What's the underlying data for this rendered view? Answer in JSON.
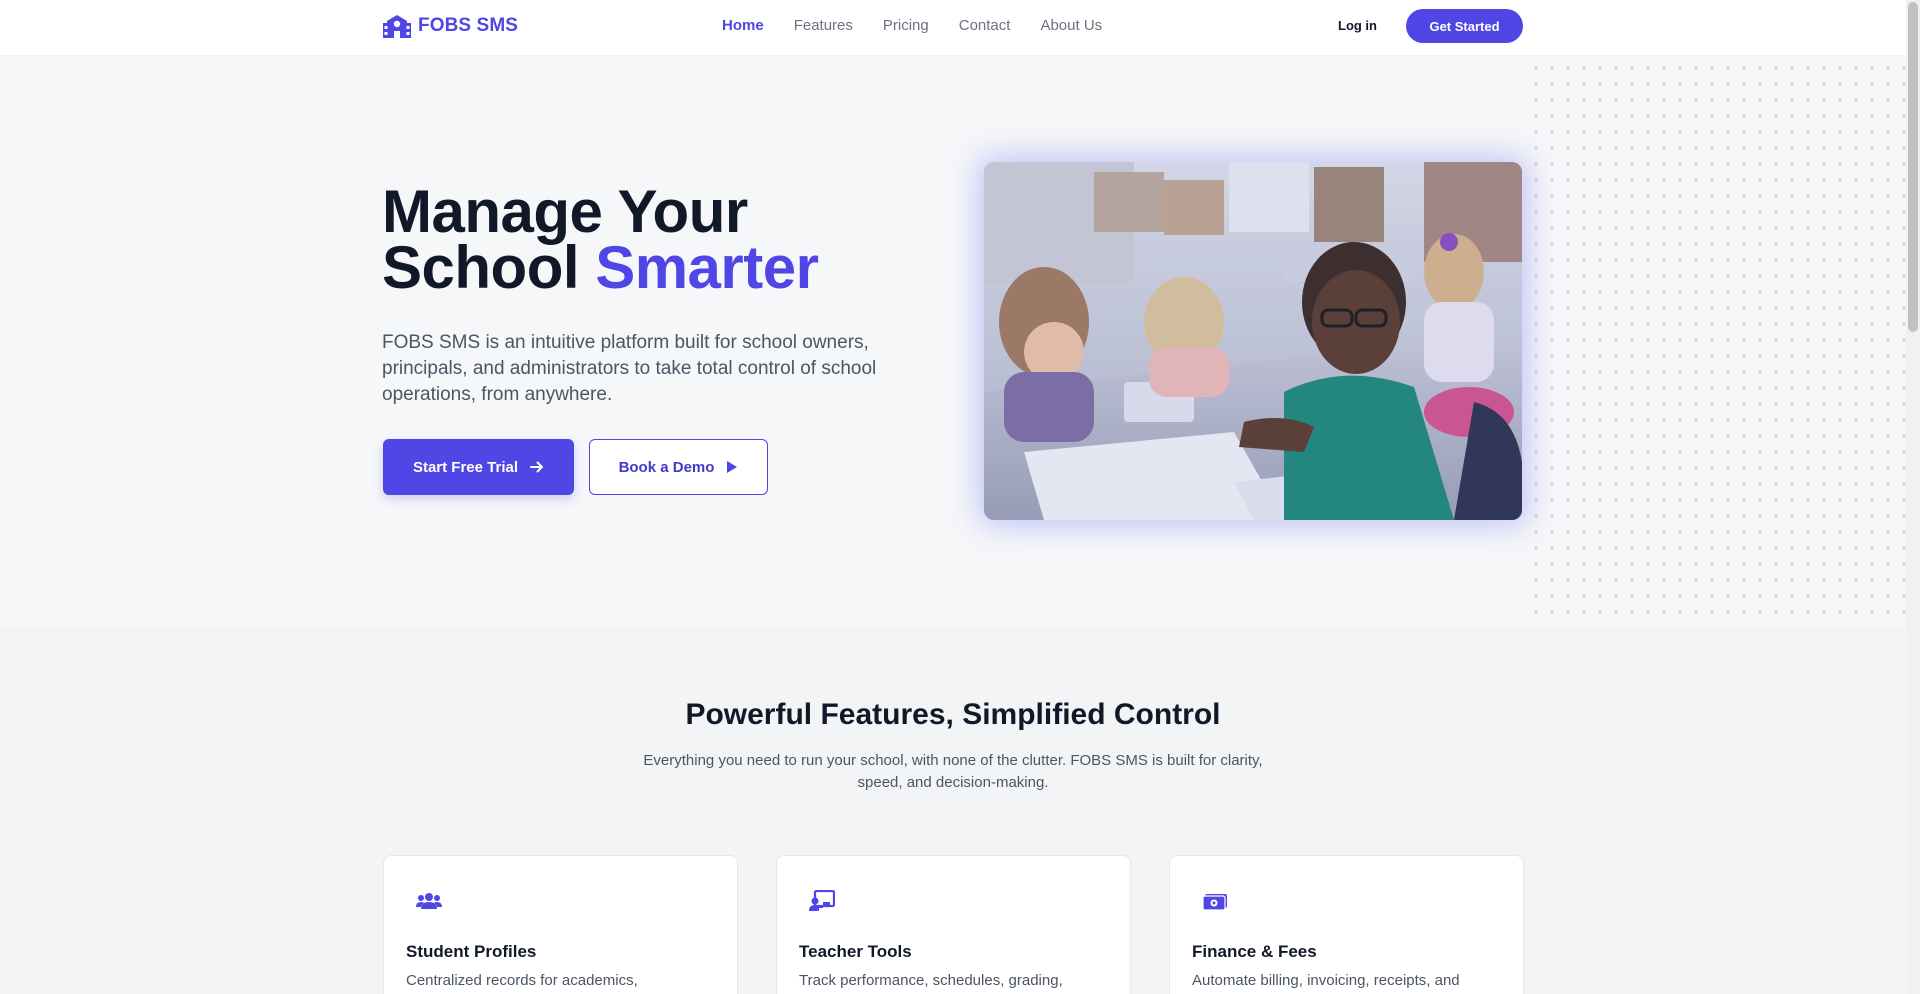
{
  "nav": {
    "brand": "FOBS SMS",
    "links": [
      "Home",
      "Features",
      "Pricing",
      "Contact",
      "About Us"
    ],
    "active": "Home",
    "login": "Log in",
    "cta": "Get Started"
  },
  "hero": {
    "title_line1": "Manage Your",
    "title_line2_plain": "School ",
    "title_line2_accent": "Smarter",
    "subtitle": "FOBS SMS is an intuitive platform built for school owners, principals, and administrators to take total control of school operations, from anywhere.",
    "primary_button": "Start Free Trial",
    "secondary_button": "Book a Demo"
  },
  "features": {
    "title": "Powerful Features, Simplified Control",
    "subtitle": "Everything you need to run your school, with none of the clutter. FOBS SMS is built for clarity, speed, and decision-making.",
    "cards": [
      {
        "icon": "users-icon",
        "title": "Student Profiles",
        "desc": "Centralized records for academics,"
      },
      {
        "icon": "chalkboard-teacher-icon",
        "title": "Teacher Tools",
        "desc": "Track performance, schedules, grading,"
      },
      {
        "icon": "money-bill-icon",
        "title": "Finance & Fees",
        "desc": "Automate billing, invoicing, receipts, and"
      }
    ]
  },
  "colors": {
    "accent": "#4f46e5",
    "hero_bg": "#f6f7f9",
    "features_bg": "#f3f4f6"
  }
}
